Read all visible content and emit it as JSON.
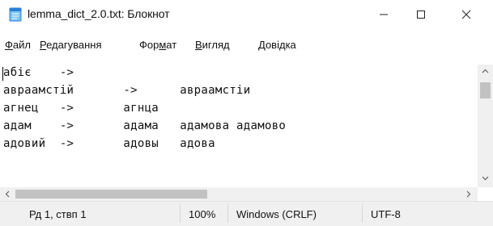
{
  "window": {
    "title": "lemma_dict_2.0.txt: Блокнот",
    "icon": "notepad-icon",
    "controls": {
      "minimize": "—",
      "maximize": "☐",
      "close": "✕"
    }
  },
  "menu": [
    {
      "label": "Файл",
      "accel": "Ф",
      "rest": "айл"
    },
    {
      "label": "Редагування",
      "accel": "Р",
      "rest": "едагування"
    },
    {
      "label": "Формат",
      "pre": "Фор",
      "accel": "м",
      "rest": "ат"
    },
    {
      "label": "Вигляд",
      "accel": "В",
      "rest": "игляд"
    },
    {
      "label": "Довідка",
      "accel": "Д",
      "rest": "овідка"
    }
  ],
  "editor": {
    "lines": [
      "абіє    ->",
      "авраамстій       ->      авраамстіи",
      "агнец   ->       агнца",
      "адам    ->       адама   адамова адамово",
      "адовий  ->       адовы   адова"
    ]
  },
  "statusbar": {
    "position": "Рд 1, ствп 1",
    "zoom": "100%",
    "line_endings": "Windows (CRLF)",
    "encoding": "UTF-8"
  },
  "colors": {
    "scrollbar_track": "#f0f0f0",
    "scrollbar_thumb": "#c2c2c2",
    "statusbar_bg": "#f0f0f0",
    "icon_blue": "#2b7fd6"
  }
}
